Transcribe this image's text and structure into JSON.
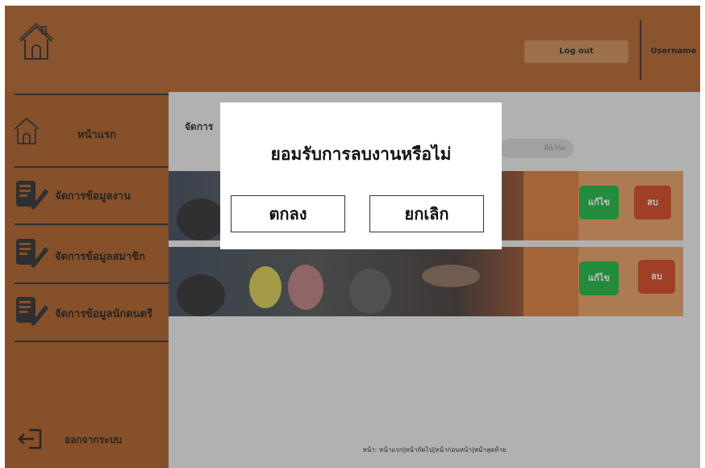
{
  "header": {
    "logout_label": "Log out",
    "username": "Username",
    "home_icon": "house-icon"
  },
  "sidebar": {
    "items": [
      {
        "label": "หน้าแรก",
        "icon": "house-icon"
      },
      {
        "label": "จัดการข้อมูลงาน",
        "icon": "document-edit-icon"
      },
      {
        "label": "จัดการข้อมูลสมาชิก",
        "icon": "document-edit-icon"
      },
      {
        "label": "จัดการข้อมูลนักดนตรี",
        "icon": "document-edit-icon"
      }
    ],
    "logout_label": "ออกจากระบบ",
    "logout_icon": "exit-icon"
  },
  "main": {
    "title": "จัดการ",
    "search_placeholder": "คีย์เวิร์ด",
    "cards": [
      {
        "edit_label": "แก้ไข",
        "delete_label": "ลบ"
      },
      {
        "edit_label": "แก้ไข",
        "delete_label": "ลบ"
      }
    ],
    "pagination": {
      "prefix": "หน้า:",
      "first": "หน้าแรก",
      "next": "หน้าถัดไป",
      "prev": "หน้าก่อนหน้า",
      "last": "หน้าสุดท้าย"
    }
  },
  "dialog": {
    "title": "ยอมรับการลบงานหรือไม่",
    "confirm_label": "ตกลง",
    "cancel_label": "ยกเลิก"
  },
  "colors": {
    "header": "#b0602a",
    "sidebar": "#a85a22",
    "card": "#e39a5e",
    "edit": "#18b23d",
    "delete": "#d0401c"
  }
}
